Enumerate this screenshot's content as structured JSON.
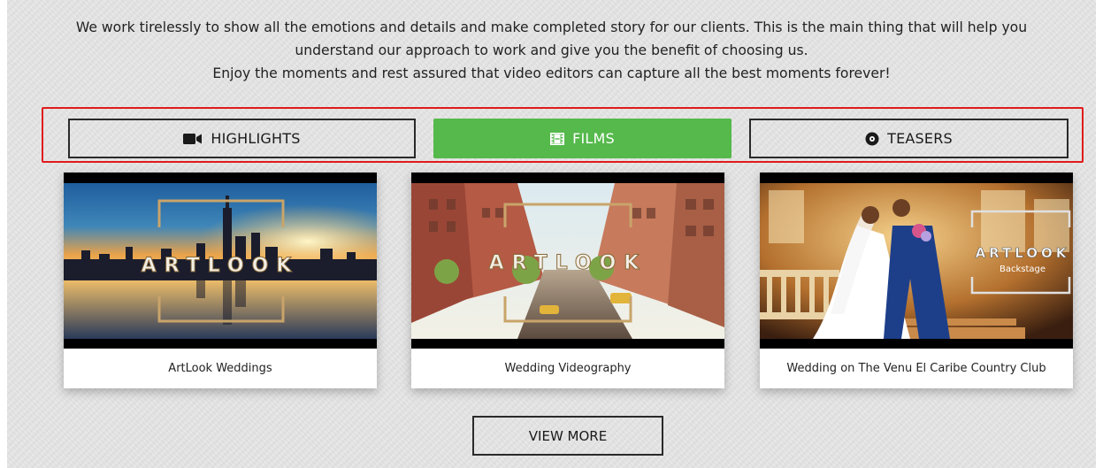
{
  "intro": {
    "line1": "We work tirelessly to show all the emotions and details and make completed story for our clients. This is the main thing that will help you",
    "line2": "understand our approach to work and give you the benefit of choosing us.",
    "line3": "Enjoy the moments and rest assured that video editors can capture all the best moments forever!"
  },
  "tabs": [
    {
      "label": "HIGHLIGHTS",
      "icon": "video-camera-icon",
      "active": false
    },
    {
      "label": "FILMS",
      "icon": "film-icon",
      "active": true
    },
    {
      "label": "TEASERS",
      "icon": "record-icon",
      "active": false
    }
  ],
  "cards": [
    {
      "title": "ArtLook Weddings",
      "overlay_text": "ARTLOOK"
    },
    {
      "title": "Wedding Videography",
      "overlay_text": "ARTLOOK"
    },
    {
      "title": "Wedding on The Venu El Caribe Country Club",
      "overlay_text": "ARTLOOK",
      "overlay_sub": "Backstage"
    }
  ],
  "view_more_label": "VIEW MORE",
  "colors": {
    "accent_green": "#55b94b",
    "highlight_red": "#e11b1b",
    "background": "#e4e4e4"
  }
}
